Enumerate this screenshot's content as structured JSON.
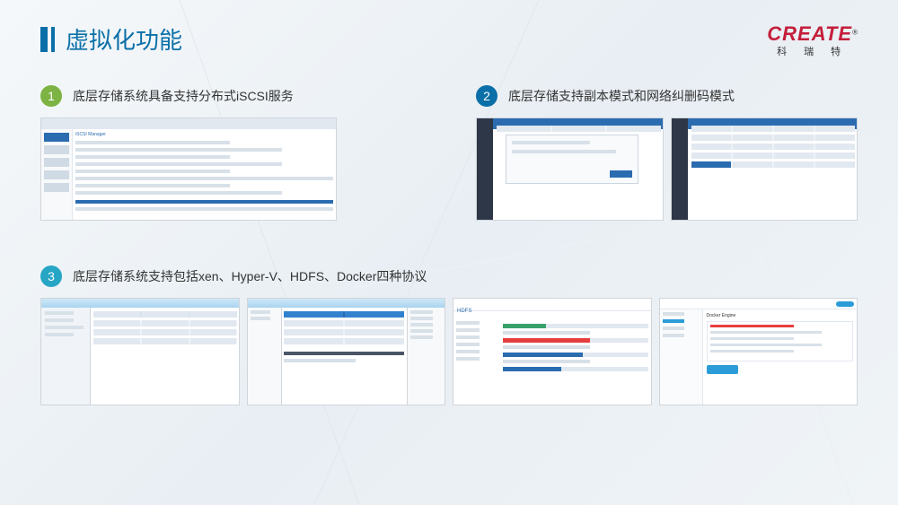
{
  "title": "虚拟化功能",
  "logo": {
    "main": "CREATE",
    "reg": "®",
    "sub": "科 瑞 特"
  },
  "points": [
    {
      "num": "1",
      "color": "green",
      "text": "底层存储系统具备支持分布式iSCSI服务"
    },
    {
      "num": "2",
      "color": "blue",
      "text": "底层存储支持副本模式和网络纠删码模式"
    },
    {
      "num": "3",
      "color": "cyan",
      "text": "底层存储系统支持包括xen、Hyper-V、HDFS、Docker四种协议"
    }
  ],
  "shot_titles": {
    "iscsi": "iSCSI Manager",
    "hdfs": "HDFS",
    "docker": "Docker Engine"
  }
}
